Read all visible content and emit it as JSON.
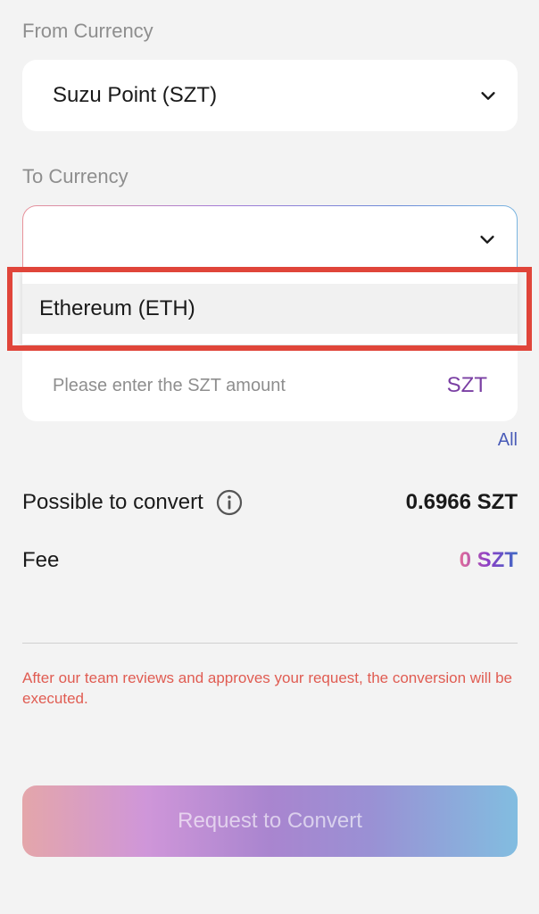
{
  "from_currency": {
    "label": "From Currency",
    "selected": "Suzu Point (SZT)"
  },
  "to_currency": {
    "label": "To Currency",
    "selected": "",
    "options": [
      "Ethereum (ETH)"
    ]
  },
  "amount": {
    "placeholder": "Please enter the SZT amount",
    "unit": "SZT",
    "all_label": "All"
  },
  "summary": {
    "possible_label": "Possible to convert",
    "possible_value": "0.6966 SZT",
    "fee_label": "Fee",
    "fee_value": "0 SZT"
  },
  "notice": "After our team reviews and approves your request, the conversion will be executed.",
  "convert_button": "Request to Convert",
  "colors": {
    "highlight_border": "#e0453a",
    "notice_text": "#e05c52",
    "unit_text": "#7a3fa3",
    "link_text": "#4a5cb8"
  },
  "icons": {
    "dropdown": "chevron-down-icon",
    "info": "info-circle-icon"
  }
}
